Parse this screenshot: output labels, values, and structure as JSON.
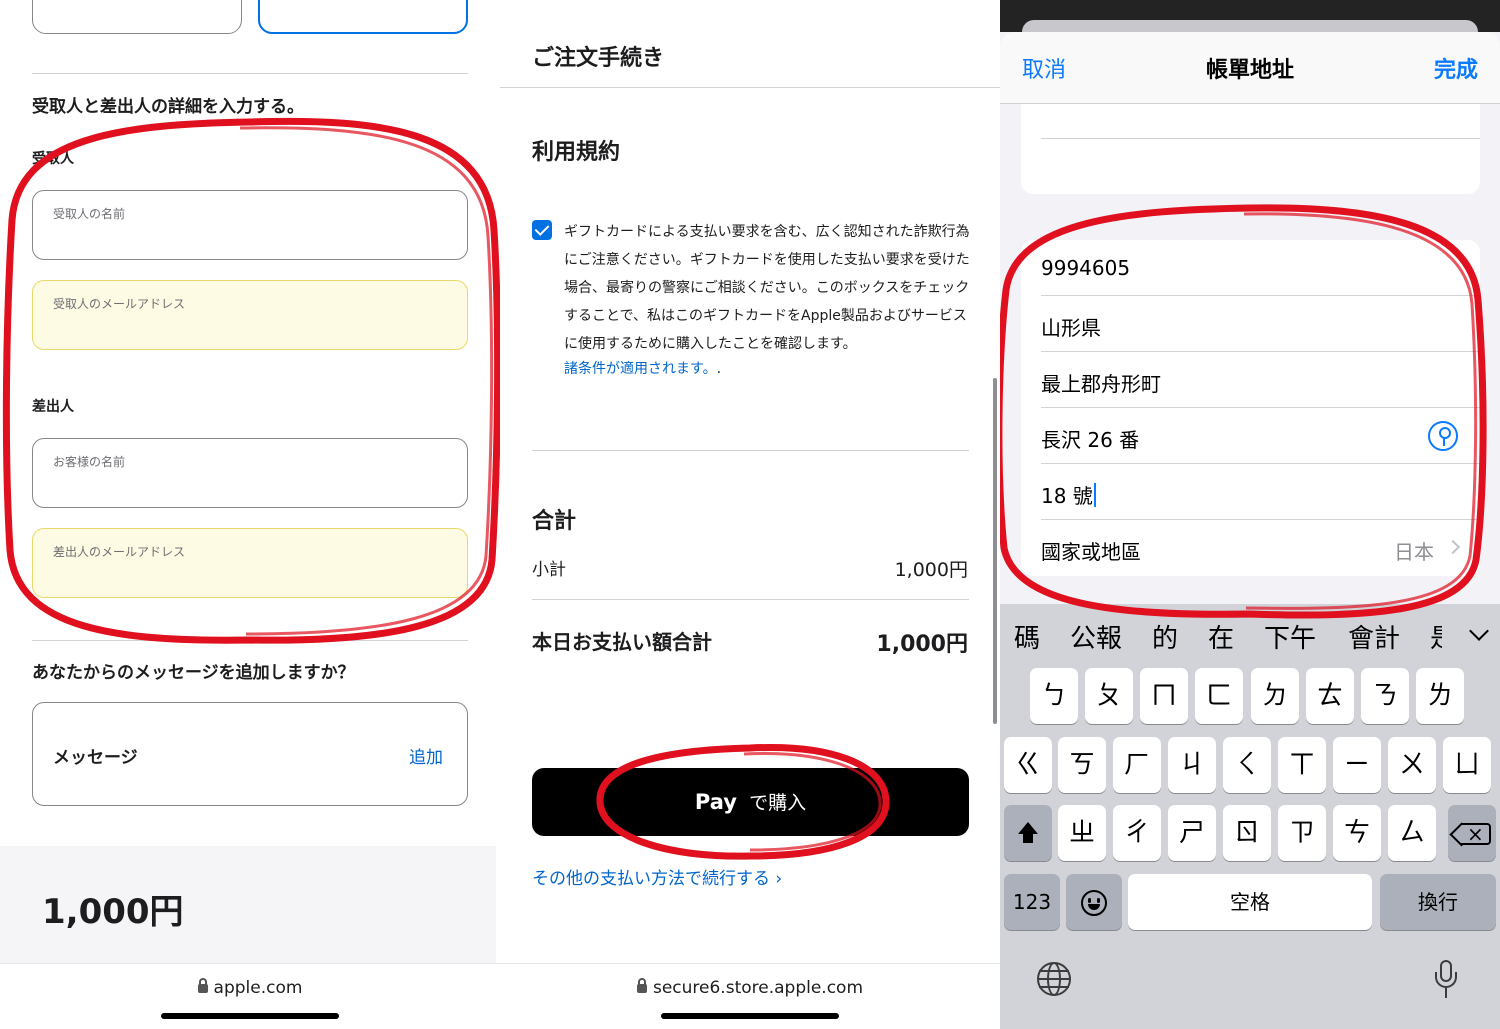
{
  "panel1": {
    "section_title": "受取人と差出人の詳細を入力する。",
    "recipient_heading": "受取人",
    "recipient_name_placeholder": "受取人の名前",
    "recipient_email_placeholder": "受取人のメールアドレス",
    "sender_heading": "差出人",
    "sender_name_placeholder": "お客様の名前",
    "sender_email_placeholder": "差出人のメールアドレス",
    "message_question": "あなたからのメッセージを追加しますか？",
    "message_label": "メッセージ",
    "message_add": "追加",
    "price": "1,000円",
    "url": "apple.com"
  },
  "panel2": {
    "order_title": "ご注文手続き",
    "terms_title": "利用規約",
    "terms_checked": true,
    "terms_text": "ギフトカードによる支払い要求を含む、広く認知された詐欺行為にご注意ください。ギフトカードを使用した支払い要求を受けた場合、最寄りの警察にご相談ください。このボックスをチェックすることで、私はこのギフトカードをApple製品およびサービスに使用するために購入したことを確認します。",
    "terms_link": "諸条件が適用されます。",
    "terms_link_suffix": ".",
    "total_title": "合計",
    "subtotal_label": "小計",
    "subtotal_value": "1,000円",
    "today_label": "本日お支払い額合計",
    "today_value": "1,000円",
    "pay_apple": "",
    "pay_word": "Pay",
    "pay_suffix": "で購入",
    "other_payment": "その他の支払い方法で続行する ›",
    "url": "secure6.store.apple.com"
  },
  "panel3": {
    "cancel": "取消",
    "title": "帳單地址",
    "done": "完成",
    "address_rows": [
      "9994605",
      "山形県",
      "最上郡舟形町",
      "長沢 26 番",
      "18 號"
    ],
    "country_label": "國家或地區",
    "country_value": "日本",
    "candidates": [
      "碼",
      "公報",
      "的",
      "在",
      "下午",
      "會計",
      "是"
    ],
    "keys_row1": [
      "ㄅ",
      "ㄆ",
      "ㄇ",
      "ㄈ",
      "ㄉ",
      "ㄊ",
      "ㄋ",
      "ㄌ"
    ],
    "keys_row2": [
      "ㄍ",
      "ㄎ",
      "ㄏ",
      "ㄐ",
      "ㄑ",
      "ㄒ",
      "ㄧ",
      "ㄨ",
      "ㄩ"
    ],
    "keys_row3": [
      "ㄓ",
      "ㄔ",
      "ㄕ",
      "ㄖ",
      "ㄗ",
      "ㄘ",
      "ㄙ"
    ],
    "key_123": "123",
    "key_space": "空格",
    "key_return": "換行",
    "icons": [
      "shift-icon",
      "delete-icon",
      "emoji-icon",
      "globe-icon",
      "mic-icon",
      "password-key-icon",
      "chevron-right-icon"
    ]
  },
  "colors": {
    "link_blue": "#0066cc",
    "ios_blue": "#0a7aff",
    "annotation_red": "#e0101e",
    "field_yellow": "#fdfbe3"
  }
}
